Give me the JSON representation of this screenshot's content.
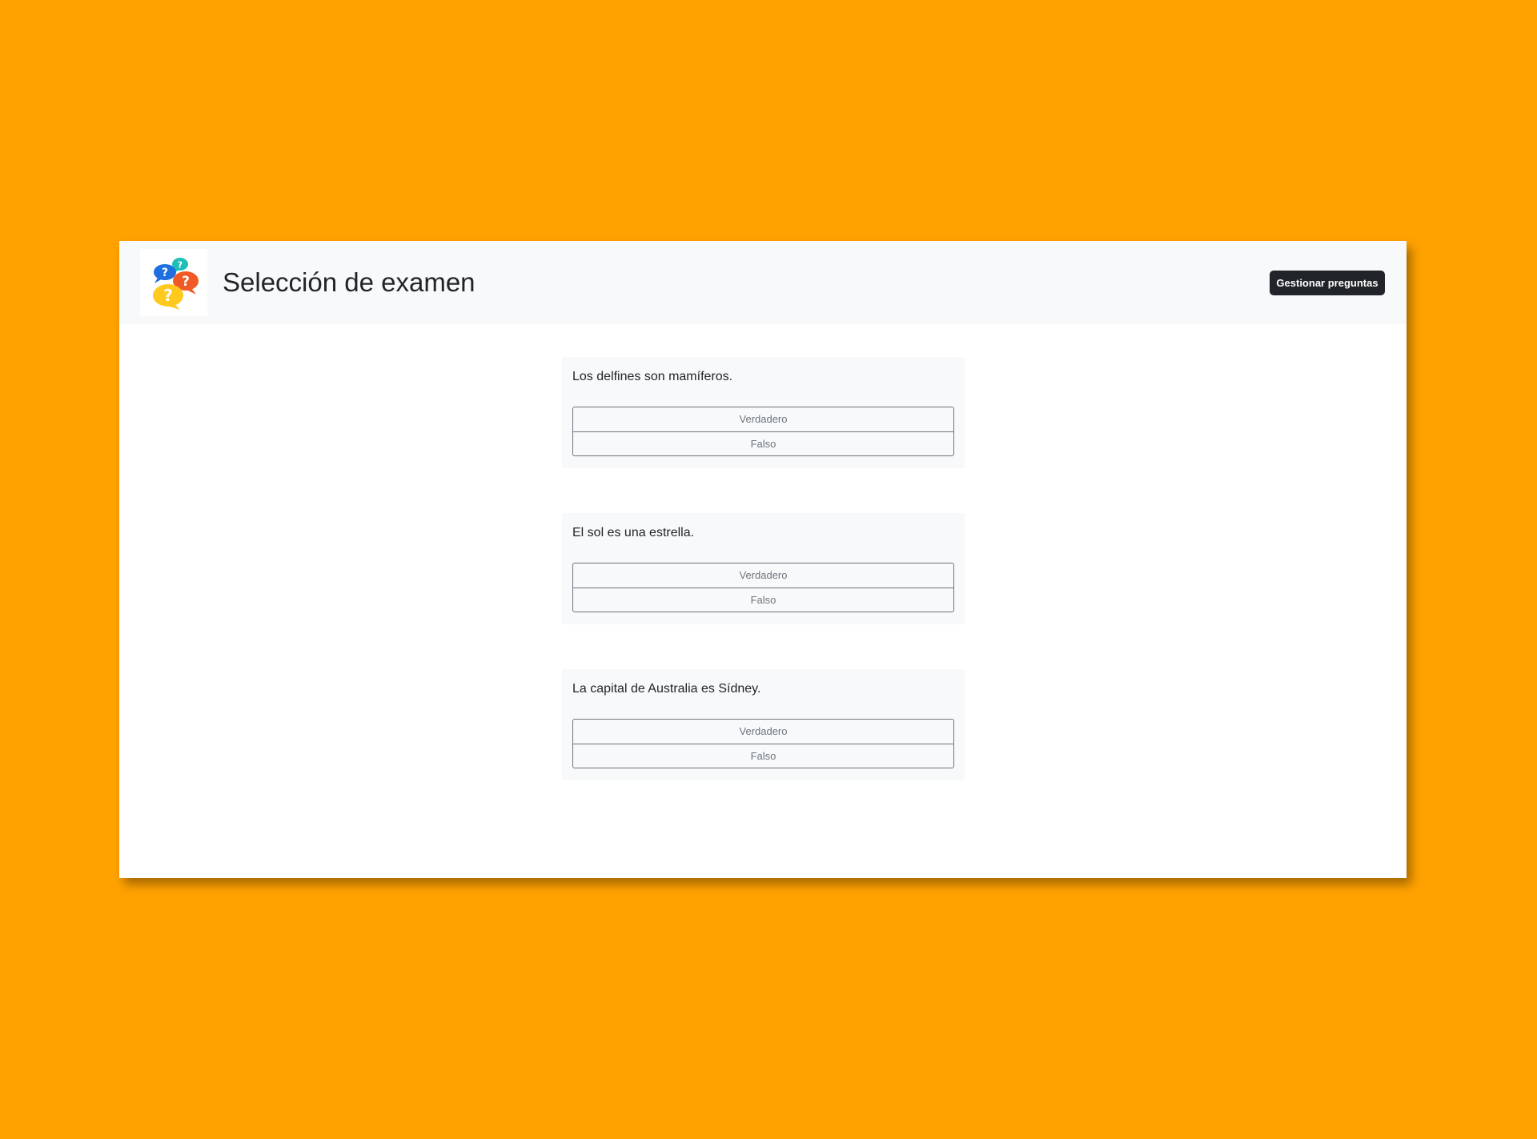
{
  "header": {
    "title": "Selección de examen",
    "manage_button": "Gestionar preguntas",
    "logo_icon": "question-bubbles-icon"
  },
  "questions": [
    {
      "text": "Los delfines son mamíferos.",
      "options": [
        "Verdadero",
        "Falso"
      ]
    },
    {
      "text": "El sol es una estrella.",
      "options": [
        "Verdadero",
        "Falso"
      ]
    },
    {
      "text": "La capital de Australia es Sídney.",
      "options": [
        "Verdadero",
        "Falso"
      ]
    }
  ],
  "colors": {
    "background": "#FFA200",
    "header_bg": "#f8f9fa",
    "button_dark": "#212529",
    "option_text": "#6c757d"
  }
}
